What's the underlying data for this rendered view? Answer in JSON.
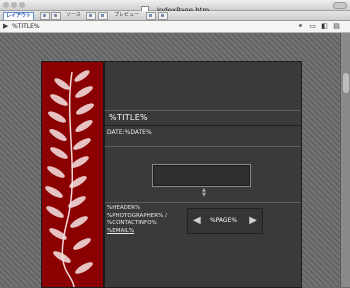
{
  "window": {
    "title": "IndexPage.htm"
  },
  "tabs": [
    {
      "label": "レイアウト"
    },
    {
      "label": "ソース"
    },
    {
      "label": "プレビュー"
    }
  ],
  "path": {
    "tag": "%TITLE%"
  },
  "page": {
    "title_placeholder": "%TITLE%",
    "date_placeholder": "DATE:%DATE%",
    "header_placeholder": "%HEADER%",
    "photographer_placeholder": "%PHOTOGRAPHER% /",
    "contact_placeholder": "%CONTACTINFO%",
    "email_placeholder": "%EMAIL%",
    "page_placeholder": "%PAGE%"
  }
}
